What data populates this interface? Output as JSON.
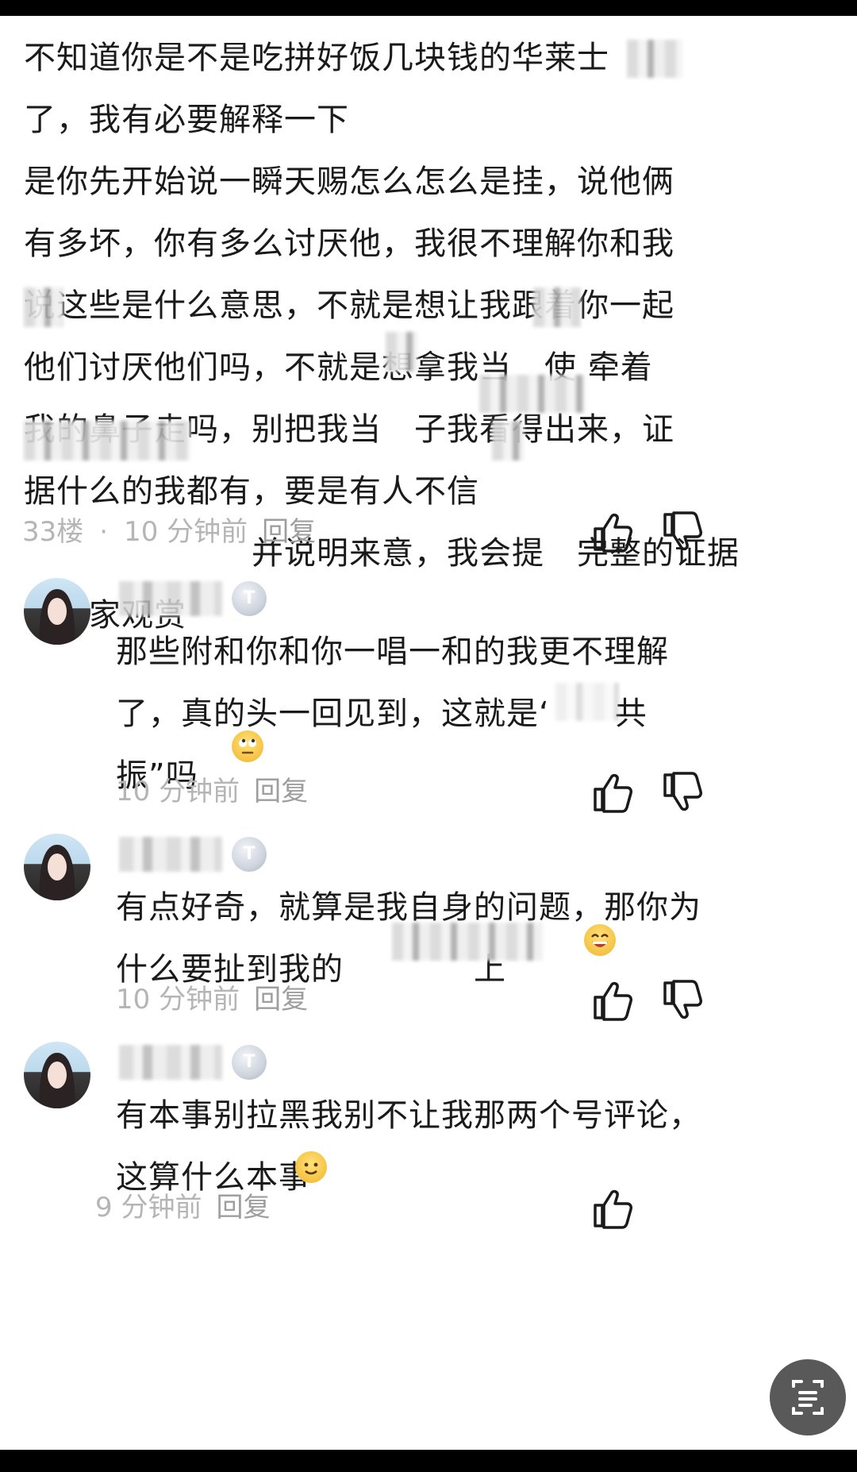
{
  "main_comment": {
    "text": "不知道你是不是吃拼好饭几块钱的华莱士\n了，我有必要解释一下\n是你先开始说一瞬天赐怎么怎么是挂，说他俩\n有多坏，你有多么讨厌他，我很不理解你和我\n说这些是什么意思，不就是想让我跟着你一起\n他们讨厌他们吗，不就是想拿我当　使 牵着\n我的鼻子走吗，别把我当　子我看得出来，证\n据什么的我都有，要是有人不信\n　　　　　　　并说明来意，我会提　完整的证据\n供大家观赏",
    "floor": "33楼",
    "separator": "·",
    "time": "10 分钟前",
    "reply_label": "回复"
  },
  "replies": [
    {
      "badge": "T",
      "text": "那些附和你和你一唱一和的我更不理解\n了，真的头一回见到，这就是‘　　共\n振”吗",
      "time": "10 分钟前",
      "reply_label": "回复",
      "emoji": "rolling-eyes-emoji"
    },
    {
      "badge": "T",
      "text": "有点好奇，就算是我自身的问题，那你为\n什么要扯到我的　　　　上",
      "time": "10 分钟前",
      "reply_label": "回复",
      "emoji": "grinning-emoji"
    },
    {
      "badge": "T",
      "text": "有本事别拉黑我别不让我那两个号评论，\n这算什么本事",
      "time": "9 分钟前",
      "reply_label": "回复",
      "emoji": "smiling-emoji"
    }
  ],
  "icons": {
    "like": "thumbs-up-icon",
    "dislike": "thumbs-down-icon",
    "fab": "text-scan-icon"
  },
  "colors": {
    "meta_gray": "#b5b5b5",
    "badge_gray": "#cfd4de"
  }
}
